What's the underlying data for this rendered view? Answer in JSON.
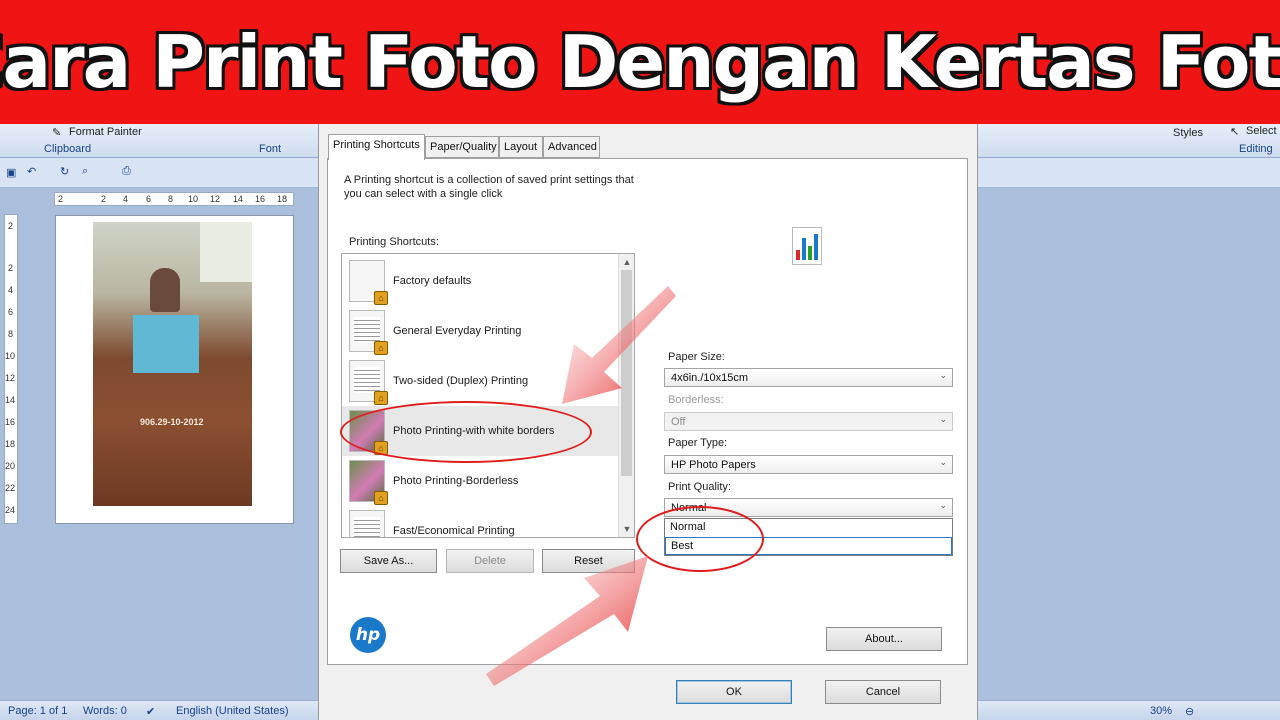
{
  "banner": {
    "title": "Cara Print Foto Dengan Kertas Foto"
  },
  "word": {
    "ribbon": {
      "format_painter": "Format Painter",
      "clipboard": "Clipboard",
      "font": "Font",
      "styles": "Styles",
      "select": "Select",
      "editing": "Editing"
    },
    "ruler_h": [
      "2",
      "2",
      "4",
      "6",
      "8",
      "10",
      "12",
      "14",
      "16",
      "18"
    ],
    "ruler_v": [
      "2",
      "2",
      "4",
      "6",
      "8",
      "10",
      "12",
      "14",
      "16",
      "18",
      "20",
      "22",
      "24"
    ],
    "photo_text": "906.29-10-2012",
    "status": {
      "page": "Page: 1 of 1",
      "words": "Words: 0",
      "language": "English (United States)",
      "zoom": "30%"
    }
  },
  "dialog": {
    "tabs": [
      "Printing Shortcuts",
      "Paper/Quality",
      "Layout",
      "Advanced"
    ],
    "description": "A Printing shortcut is a collection of saved print settings that you can select with a single click",
    "shortcuts_label": "Printing Shortcuts:",
    "shortcuts": [
      {
        "label": "Factory defaults",
        "selected": false
      },
      {
        "label": "General Everyday Printing",
        "selected": false
      },
      {
        "label": "Two-sided (Duplex) Printing",
        "selected": false
      },
      {
        "label": "Photo Printing-with white borders",
        "selected": true
      },
      {
        "label": "Photo Printing-Borderless",
        "selected": false
      },
      {
        "label": "Fast/Economical Printing",
        "selected": false
      }
    ],
    "buttons": {
      "save_as": "Save As...",
      "delete": "Delete",
      "reset": "Reset",
      "about": "About...",
      "ok": "OK",
      "cancel": "Cancel"
    },
    "fields": {
      "paper_size": {
        "label": "Paper Size:",
        "value": "4x6in./10x15cm"
      },
      "borderless": {
        "label": "Borderless:",
        "value": "Off"
      },
      "paper_type": {
        "label": "Paper Type:",
        "value": "HP Photo Papers"
      },
      "print_quality": {
        "label": "Print Quality:",
        "value": "Normal",
        "options": [
          "Normal",
          "Best"
        ]
      }
    },
    "logo_text": "hp",
    "colors": {
      "accent": "#1a7ac9",
      "annotation": "#e01d1d",
      "banner": "#f01414"
    }
  }
}
